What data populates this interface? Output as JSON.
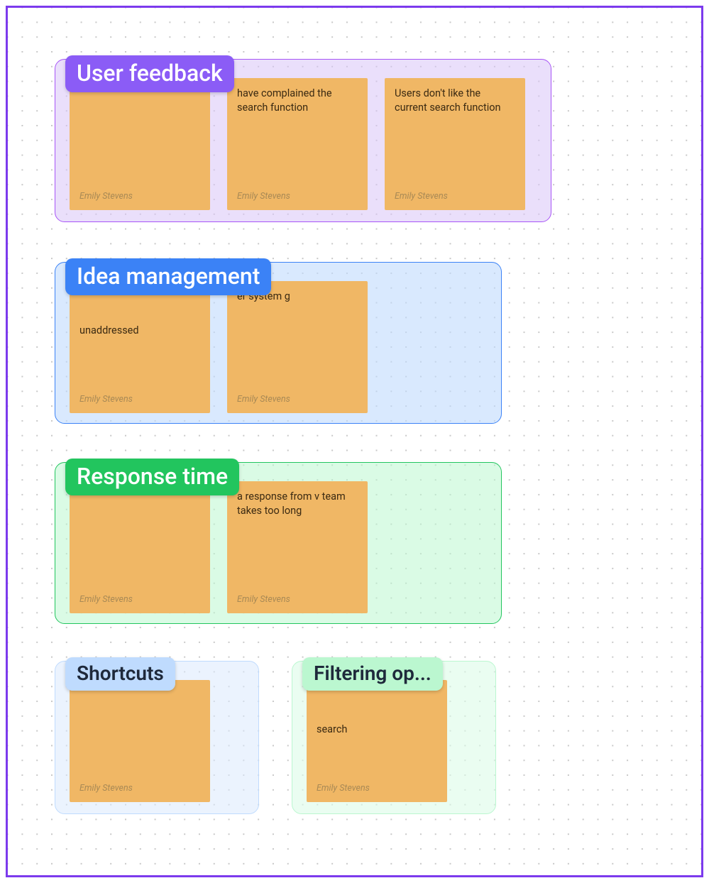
{
  "author": "Emily Stevens",
  "groups": {
    "user_feedback": {
      "title": "User feedback",
      "notes": [
        {
          "text": "",
          "partial": ""
        },
        {
          "text": "have complained the search function",
          "partial": "have complained the search function"
        },
        {
          "text": "Users don't like the current search function"
        }
      ]
    },
    "idea_management": {
      "title": "Idea management",
      "notes": [
        {
          "text": "unaddressed"
        },
        {
          "text": "er system g",
          "partial": "er system"
        }
      ]
    },
    "response_time": {
      "title": "Response time",
      "notes": [
        {
          "text": ""
        },
        {
          "text": "a response from v team takes too long",
          "partial": "a response from team takes too long"
        }
      ]
    },
    "shortcuts": {
      "title": "Shortcuts",
      "notes": [
        {
          "text": ""
        }
      ]
    },
    "filtering": {
      "title": "Filtering op...",
      "notes": [
        {
          "text": "search"
        }
      ]
    }
  }
}
